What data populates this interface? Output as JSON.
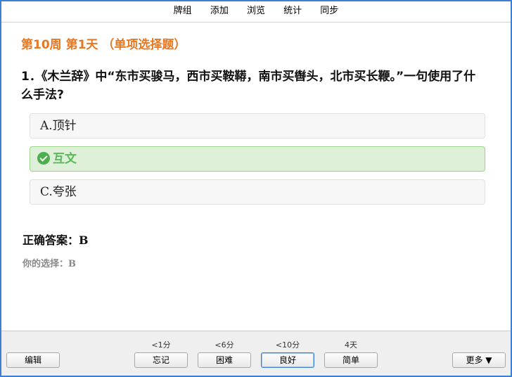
{
  "menu": {
    "items": [
      "牌组",
      "添加",
      "浏览",
      "统计",
      "同步"
    ]
  },
  "card": {
    "deck_title": "第10周 第1天 （单项选择题）",
    "question": "1．《木兰辞》中“东市买骏马，西市买鞍鞯，南市买辔头，北市买长鞭。”一句使用了什么手法?",
    "options": [
      {
        "label": "A.顶针",
        "state": "normal"
      },
      {
        "label": "互文",
        "state": "correct"
      },
      {
        "label": "C.夸张",
        "state": "normal"
      }
    ],
    "answer_label": "正确答案：",
    "answer_value": "B",
    "your_choice_label": "你的选择：",
    "your_choice_value": "B"
  },
  "bottom": {
    "edit_label": "编辑",
    "more_label": "更多 ▼",
    "answers": [
      {
        "label": "忘记",
        "time": "<1分"
      },
      {
        "label": "困难",
        "time": "<6分"
      },
      {
        "label": "良好",
        "time": "<10分",
        "default": true
      },
      {
        "label": "简单",
        "time": "4天"
      }
    ]
  },
  "colors": {
    "accent": "#e87722",
    "correct_bg": "#dff0d8",
    "correct_text": "#5cb85c",
    "window_border": "#3b7fd8"
  }
}
